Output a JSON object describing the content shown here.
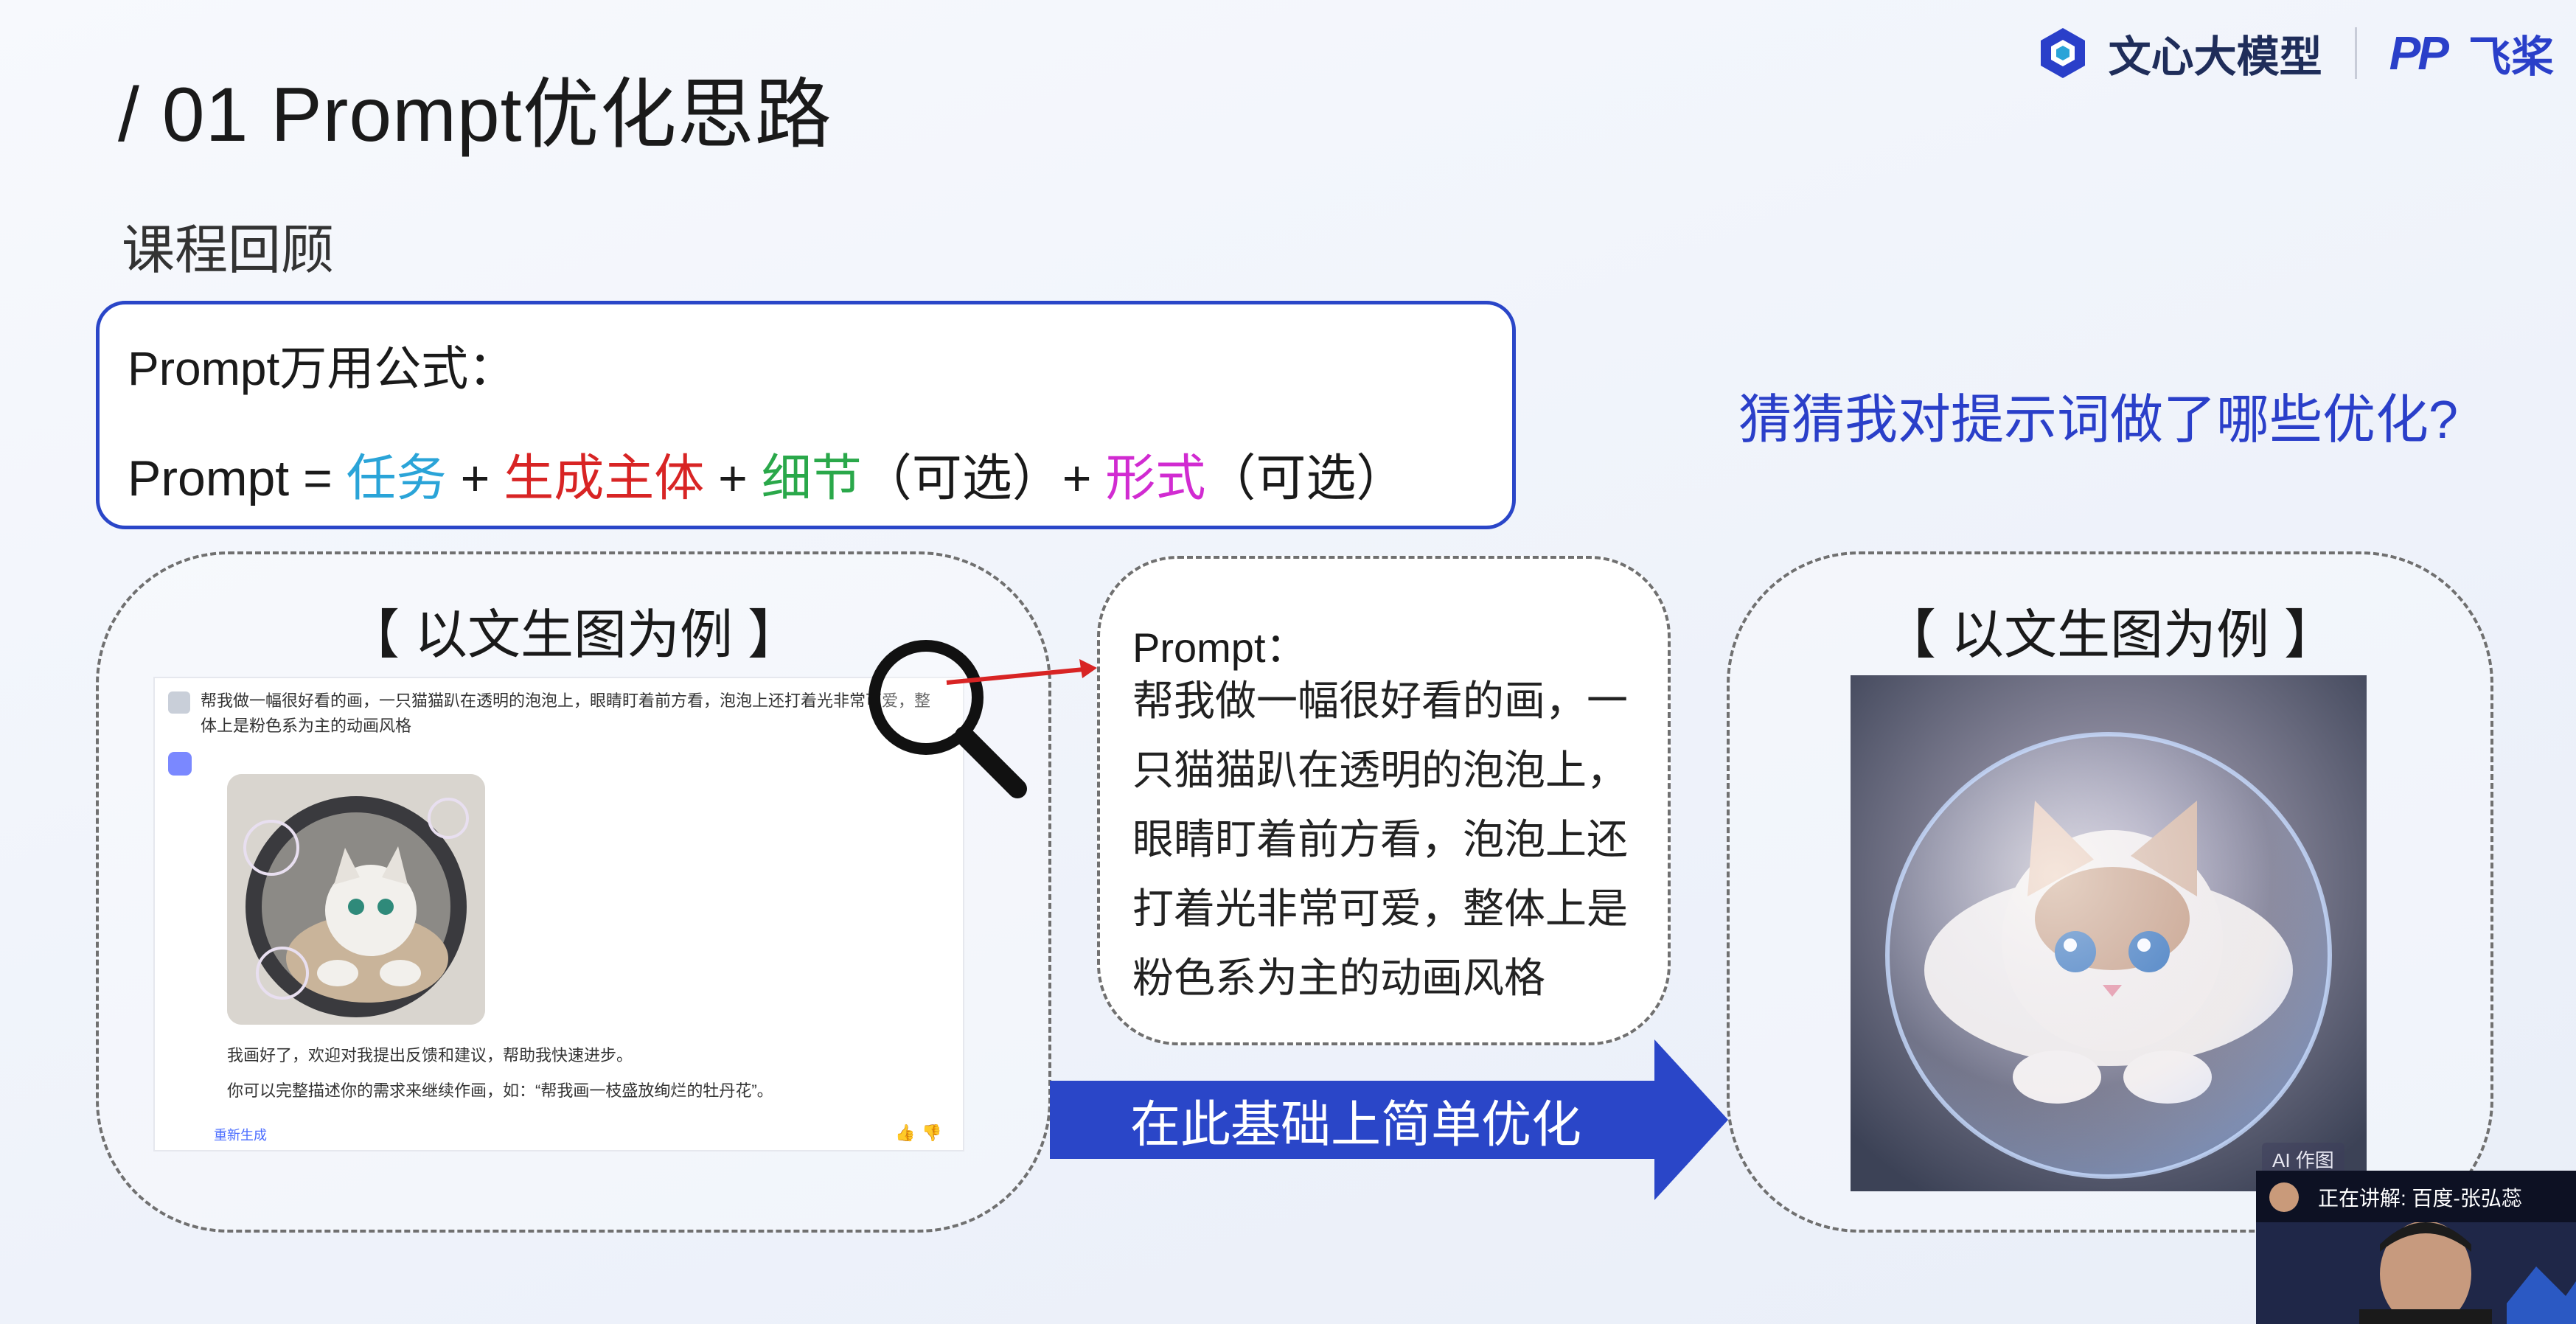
{
  "slide": {
    "title": "/ 01  Prompt优化思路",
    "subtitle": "课程回顾",
    "brand": {
      "name": "文心大模型",
      "partner_logo_text": "PP",
      "partner_name": "飞桨"
    }
  },
  "formula": {
    "label": "Prompt万用公式：",
    "prefix": "Prompt = ",
    "task": "任务",
    "plus1": " + ",
    "subject": "生成主体",
    "plus2": " + ",
    "detail": "细节",
    "optional1": "（可选）+ ",
    "form": "形式",
    "optional2": "（可选）"
  },
  "question": "猜猜我对提示词做了哪些优化?",
  "left_card": {
    "title": "【 以文生图为例 】",
    "chat": {
      "question": "帮我做一幅很好看的画，一只猫猫趴在透明的泡泡上，眼睛盯着前方看，泡泡上还打着光非常可爱，整体上是粉色系为主的动画风格",
      "reply_1": "我画好了，欢迎对我提出反馈和建议，帮助我快速进步。",
      "reply_2": "你可以完整描述你的需求来继续作画，如：“帮我画一枝盛放绚烂的牡丹花”。",
      "regenerate": "重新生成"
    }
  },
  "prompt_card": {
    "label": "Prompt：",
    "text": "帮我做一幅很好看的画，一只猫猫趴在透明的泡泡上，眼睛盯着前方看，泡泡上还打着光非常可爱，整体上是粉色系为主的动画风格"
  },
  "arrow_label": "在此基础上简单优化",
  "right_card": {
    "title": "【 以文生图为例 】",
    "badge": "AI 作图"
  },
  "presenter": {
    "status": "正在讲解:  百度-张弘蕊"
  },
  "colors": {
    "accent": "#2a46c8",
    "task": "#2aa4d8",
    "subject": "#d82424",
    "detail": "#2aa84a",
    "form": "#d12bd1",
    "question": "#2a3fc9"
  }
}
